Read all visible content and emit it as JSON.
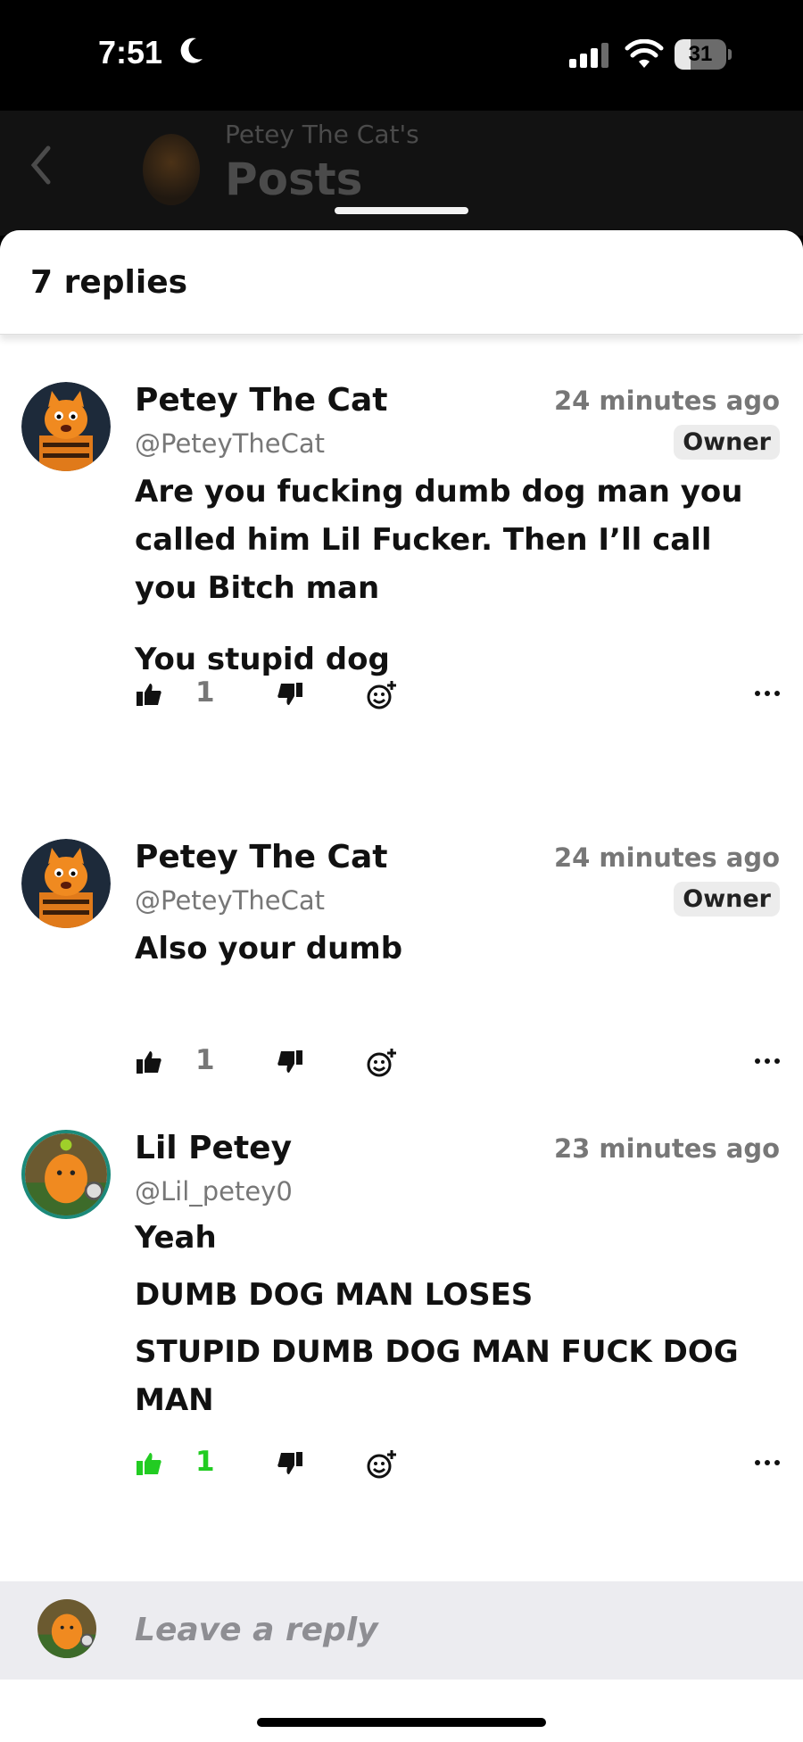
{
  "status": {
    "time": "7:51",
    "battery": "31",
    "battery_level": 0.31
  },
  "background_header": {
    "subtitle": "Petey The Cat's",
    "title": "Posts"
  },
  "sheet": {
    "count_label": "7 replies"
  },
  "comments": [
    {
      "name": "Petey The Cat",
      "handle": "@PeteyTheCat",
      "time": "24 minutes ago",
      "badge": "Owner",
      "paragraphs": [
        "Are you fucking dumb dog man you called him Lil Fucker. Then I’ll call you Bitch man",
        "You stupid dog"
      ],
      "likes": "1",
      "liked": false
    },
    {
      "name": "Petey The Cat",
      "handle": "@PeteyTheCat",
      "time": "24 minutes ago",
      "badge": "Owner",
      "paragraphs": [
        "Also your dumb"
      ],
      "likes": "1",
      "liked": false
    },
    {
      "name": "Lil Petey",
      "handle": "@Lil_petey0",
      "time": "23 minutes ago",
      "badge": "",
      "paragraphs": [
        "Yeah",
        "DUMB DOG MAN LOSES",
        "STUPID DUMB DOG MAN FUCK DOG MAN"
      ],
      "likes": "1",
      "liked": true
    }
  ],
  "reply_bar": {
    "placeholder": "Leave a reply"
  },
  "colors": {
    "liked_green": "#22cc22",
    "muted_gray": "#777777",
    "reply_bar_bg": "#ececf0"
  },
  "icons": [
    "moon-icon",
    "signal-icon",
    "wifi-icon",
    "battery-icon",
    "back-chevron-icon",
    "thumbs-up-icon",
    "thumbs-down-icon",
    "add-reaction-icon",
    "more-icon"
  ]
}
